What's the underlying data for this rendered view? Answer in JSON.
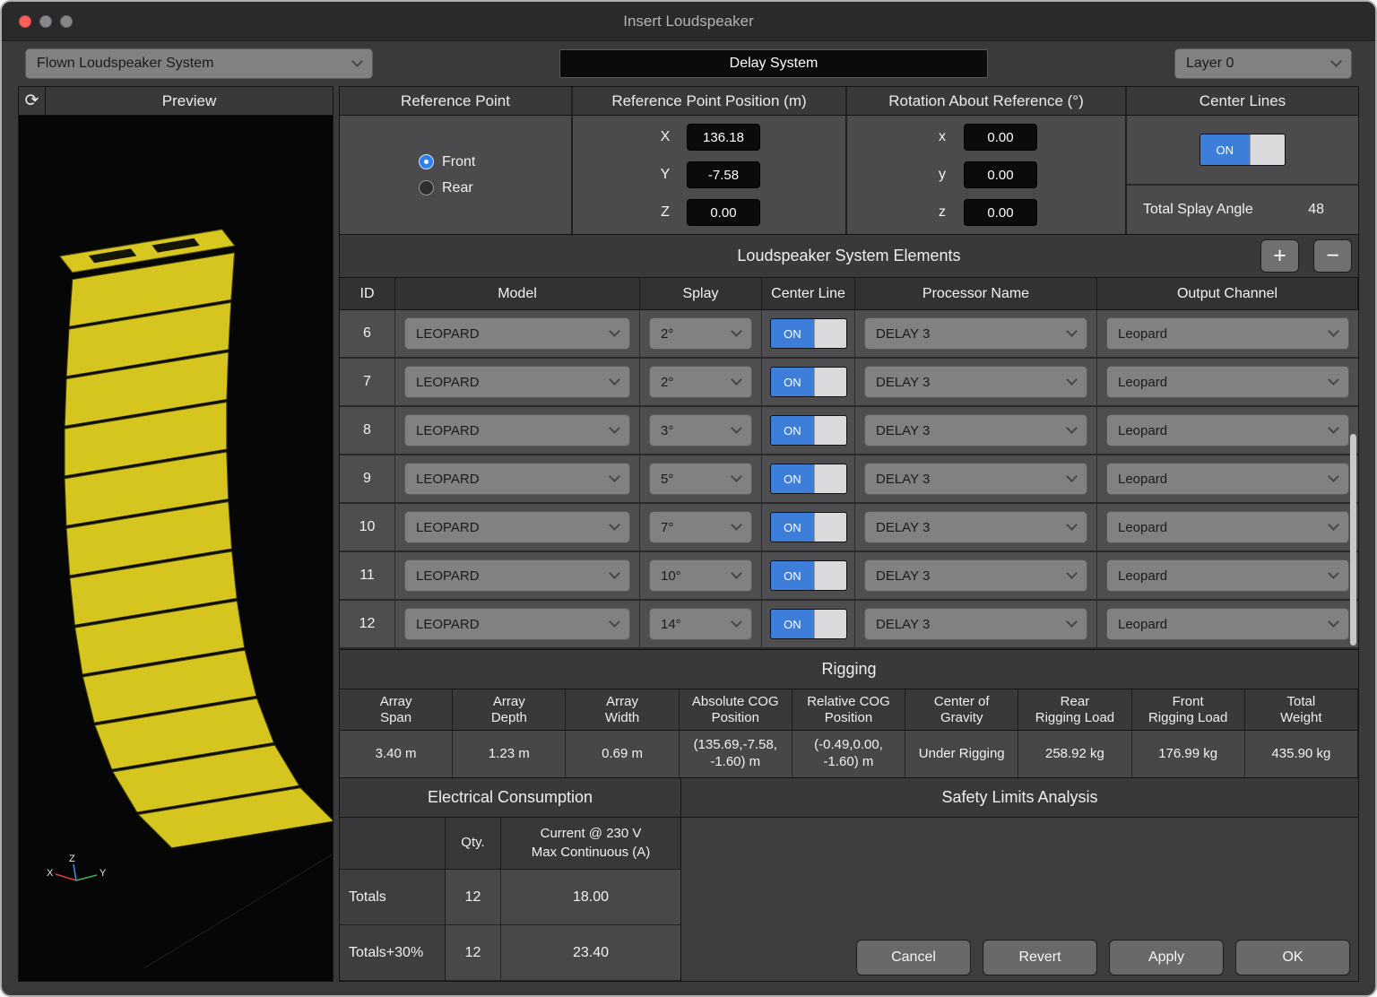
{
  "window": {
    "title": "Insert Loudspeaker"
  },
  "toolbar": {
    "system_type": "Flown Loudspeaker System",
    "name_value": "Delay System",
    "layer": "Layer 0"
  },
  "preview": {
    "title": "Preview",
    "axis": {
      "x": "X",
      "y": "Y",
      "z": "Z"
    }
  },
  "reference": {
    "title": "Reference Point",
    "options": [
      {
        "label": "Front",
        "selected": true
      },
      {
        "label": "Rear",
        "selected": false
      }
    ]
  },
  "position": {
    "title": "Reference Point Position (m)",
    "rows": [
      {
        "label": "X",
        "value": "136.18"
      },
      {
        "label": "Y",
        "value": "-7.58"
      },
      {
        "label": "Z",
        "value": "0.00"
      }
    ]
  },
  "rotation": {
    "title": "Rotation About Reference (°)",
    "rows": [
      {
        "label": "x",
        "value": "0.00"
      },
      {
        "label": "y",
        "value": "0.00"
      },
      {
        "label": "z",
        "value": "0.00"
      }
    ]
  },
  "center_lines": {
    "title": "Center Lines",
    "toggle": "ON",
    "splay_label": "Total Splay Angle",
    "splay_value": "48"
  },
  "elements": {
    "title": "Loudspeaker System Elements",
    "add": "+",
    "remove": "−",
    "columns": [
      "ID",
      "Model",
      "Splay",
      "Center Line",
      "Processor Name",
      "Output Channel"
    ],
    "rows": [
      {
        "id": "6",
        "model": "LEOPARD",
        "splay": "2°",
        "center_line": "ON",
        "processor": "DELAY 3",
        "output": "Leopard"
      },
      {
        "id": "7",
        "model": "LEOPARD",
        "splay": "2°",
        "center_line": "ON",
        "processor": "DELAY 3",
        "output": "Leopard"
      },
      {
        "id": "8",
        "model": "LEOPARD",
        "splay": "3°",
        "center_line": "ON",
        "processor": "DELAY 3",
        "output": "Leopard"
      },
      {
        "id": "9",
        "model": "LEOPARD",
        "splay": "5°",
        "center_line": "ON",
        "processor": "DELAY 3",
        "output": "Leopard"
      },
      {
        "id": "10",
        "model": "LEOPARD",
        "splay": "7°",
        "center_line": "ON",
        "processor": "DELAY 3",
        "output": "Leopard"
      },
      {
        "id": "11",
        "model": "LEOPARD",
        "splay": "10°",
        "center_line": "ON",
        "processor": "DELAY 3",
        "output": "Leopard"
      },
      {
        "id": "12",
        "model": "LEOPARD",
        "splay": "14°",
        "center_line": "ON",
        "processor": "DELAY 3",
        "output": "Leopard"
      }
    ]
  },
  "rigging": {
    "title": "Rigging",
    "columns": [
      "Array\nSpan",
      "Array\nDepth",
      "Array\nWidth",
      "Absolute COG\nPosition",
      "Relative COG\nPosition",
      "Center of\nGravity",
      "Rear\nRigging Load",
      "Front\nRigging Load",
      "Total\nWeight"
    ],
    "values": [
      "3.40 m",
      "1.23 m",
      "0.69 m",
      "(135.69,-7.58,\n-1.60) m",
      "(-0.49,0.00,\n-1.60) m",
      "Under Rigging",
      "258.92 kg",
      "176.99 kg",
      "435.90 kg"
    ]
  },
  "electrical": {
    "title": "Electrical Consumption",
    "qty_header": "Qty.",
    "current_header_line1": "Current @ 230 V",
    "current_header_line2": "Max Continuous (A)",
    "rows": [
      {
        "label": "Totals",
        "qty": "12",
        "current": "18.00"
      },
      {
        "label": "Totals+30%",
        "qty": "12",
        "current": "23.40"
      }
    ]
  },
  "safety": {
    "title": "Safety Limits Analysis"
  },
  "actions": {
    "cancel": "Cancel",
    "revert": "Revert",
    "apply": "Apply",
    "ok": "OK"
  }
}
